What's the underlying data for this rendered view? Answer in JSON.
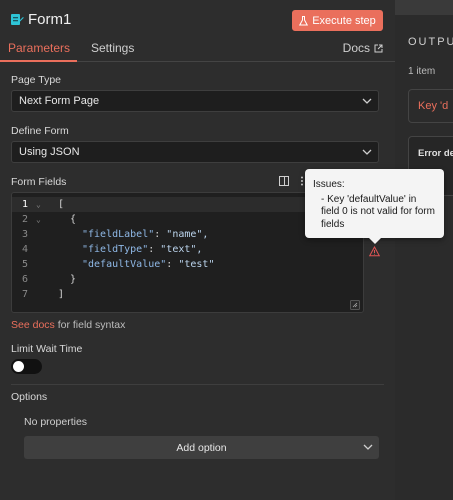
{
  "header": {
    "node_title": "Form1",
    "execute_label": "Execute step"
  },
  "tabs": {
    "parameters": "Parameters",
    "settings": "Settings",
    "docs": "Docs"
  },
  "fields": {
    "page_type_label": "Page Type",
    "page_type_value": "Next Form Page",
    "define_form_label": "Define Form",
    "define_form_value": "Using JSON",
    "form_fields_label": "Form Fields"
  },
  "editor": {
    "lines": [
      {
        "n": "1",
        "text": "["
      },
      {
        "n": "2",
        "text": "{"
      },
      {
        "n": "3",
        "key": "\"fieldLabel\"",
        "value": "\"name\","
      },
      {
        "n": "4",
        "key": "\"fieldType\"",
        "value": "\"text\","
      },
      {
        "n": "5",
        "key": "\"defaultValue\"",
        "value": "\"test\""
      },
      {
        "n": "6",
        "text": "}"
      },
      {
        "n": "7",
        "text": "]"
      }
    ]
  },
  "see_docs": {
    "link": "See docs",
    "rest": " for field syntax"
  },
  "limit_wait": {
    "label": "Limit Wait Time",
    "enabled": false
  },
  "options": {
    "label": "Options",
    "empty_text": "No properties",
    "add_label": "Add option"
  },
  "tooltip": {
    "title": "Issues:",
    "message": "- Key 'defaultValue' in field 0 is not valid for form fields"
  },
  "right_panel": {
    "title": "OUTPUT",
    "count": "1 item",
    "box1_text": "Key 'd",
    "box2_title": "Error de",
    "box2_text": "Ot"
  },
  "colors": {
    "accent": "#ea6f5c",
    "panel_bg": "#2d2d2d",
    "editor_bg": "#1f1f1f"
  },
  "icons": [
    "form-node-icon",
    "flask-icon",
    "external-link-icon",
    "chevron-down-icon",
    "expand-editor-icon",
    "more-vertical-icon",
    "warning-icon",
    "resize-handle-icon"
  ]
}
